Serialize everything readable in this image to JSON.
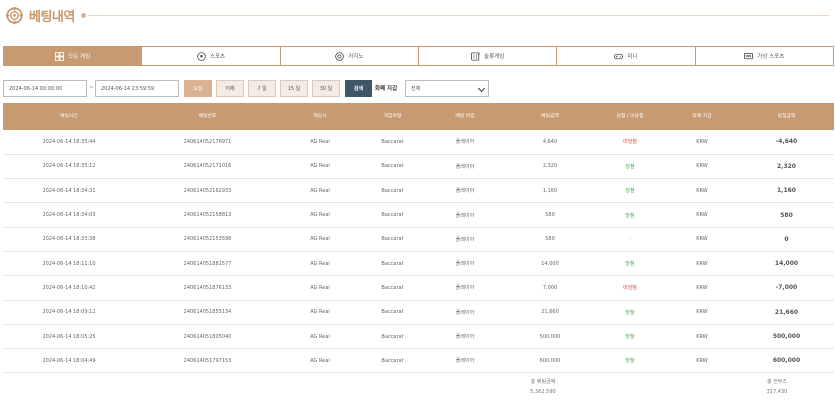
{
  "page": {
    "title": "베팅내역"
  },
  "tabs": [
    {
      "label": "모든 게임",
      "icon": "all-games-icon",
      "active": true
    },
    {
      "label": "스포츠",
      "icon": "soccer-ball-icon",
      "active": false
    },
    {
      "label": "카지노",
      "icon": "casino-chip-icon",
      "active": false
    },
    {
      "label": "슬롯게임",
      "icon": "slot-machine-icon",
      "active": false
    },
    {
      "label": "미니",
      "icon": "gamepad-icon",
      "active": false
    },
    {
      "label": "가상 스포츠",
      "icon": "virtual-sports-icon",
      "active": false
    }
  ],
  "filters": {
    "date_from": "2024-06-14 00:00:00",
    "date_to": "2024-06-14 23:59:59",
    "separator": "~",
    "today_label": "오늘",
    "yesterday_label": "어제",
    "week_label": "7 일",
    "half_month_label": "15 일",
    "month_label": "30 일",
    "search_label": "검색",
    "currency_label": "화폐 지갑",
    "currency_value": "전체"
  },
  "table": {
    "headers": [
      "베팅시간",
      "베팅번호",
      "제공사",
      "게임유형",
      "베팅 타입",
      "베팅금액",
      "당첨 / 미당첨",
      "화폐 지갑",
      "당첨금액"
    ],
    "rows": [
      {
        "time": "2024-06-14 18:35:44",
        "id": "240614052176971",
        "provider": "AG Real",
        "game": "Baccarat",
        "type": "플레이어",
        "bet": "4,640",
        "result": "미당첨",
        "result_kind": "pending",
        "currency": "KRW",
        "win": "-4,640"
      },
      {
        "time": "2024-06-14 18:35:12",
        "id": "240614052171016",
        "provider": "AG Real",
        "game": "Baccarat",
        "type": "플레이어",
        "bet": "2,320",
        "result": "당첨",
        "result_kind": "win",
        "currency": "KRW",
        "win": "2,320"
      },
      {
        "time": "2024-06-14 18:34:31",
        "id": "240614052162933",
        "provider": "AG Real",
        "game": "Baccarat",
        "type": "플레이어",
        "bet": "1,160",
        "result": "당첨",
        "result_kind": "win",
        "currency": "KRW",
        "win": "1,160"
      },
      {
        "time": "2024-06-14 18:34:03",
        "id": "240614052158813",
        "provider": "AG Real",
        "game": "Baccarat",
        "type": "플레이어",
        "bet": "580",
        "result": "당첨",
        "result_kind": "win",
        "currency": "KRW",
        "win": "580"
      },
      {
        "time": "2024-06-14 18:33:38",
        "id": "240614052153598",
        "provider": "AG Real",
        "game": "Baccarat",
        "type": "플레이어",
        "bet": "580",
        "result": "-",
        "result_kind": "dash",
        "currency": "KRW",
        "win": "0"
      },
      {
        "time": "2024-06-14 18:11:10",
        "id": "240614051881577",
        "provider": "AG Real",
        "game": "Baccarat",
        "type": "플레이어",
        "bet": "14,000",
        "result": "당첨",
        "result_kind": "win",
        "currency": "KRW",
        "win": "14,000"
      },
      {
        "time": "2024-06-14 18:10:42",
        "id": "240614051876133",
        "provider": "AG Real",
        "game": "Baccarat",
        "type": "플레이어",
        "bet": "7,000",
        "result": "미당첨",
        "result_kind": "pending",
        "currency": "KRW",
        "win": "-7,000"
      },
      {
        "time": "2024-06-14 18:09:12",
        "id": "240614051855134",
        "provider": "AG Real",
        "game": "Baccarat",
        "type": "플레이어",
        "bet": "21,660",
        "result": "당첨",
        "result_kind": "win",
        "currency": "KRW",
        "win": "21,660"
      },
      {
        "time": "2024-06-14 18:05:25",
        "id": "240614051805040",
        "provider": "AG Real",
        "game": "Baccarat",
        "type": "플레이어",
        "bet": "500,000",
        "result": "당첨",
        "result_kind": "win",
        "currency": "KRW",
        "win": "500,000"
      },
      {
        "time": "2024-06-14 18:04:49",
        "id": "240614051797153",
        "provider": "AG Real",
        "game": "Baccarat",
        "type": "플레이어",
        "bet": "600,000",
        "result": "당첨",
        "result_kind": "win",
        "currency": "KRW",
        "win": "600,000"
      }
    ]
  },
  "totals": {
    "bet_label": "총 베팅금액",
    "bet_value": "5,362,590",
    "win_label": "총 전부즈",
    "win_value": "317,430"
  },
  "colors": {
    "accent": "#c79a71",
    "search_button": "#3e5766",
    "win": "#2fae3a",
    "lose": "#e03a3a"
  }
}
